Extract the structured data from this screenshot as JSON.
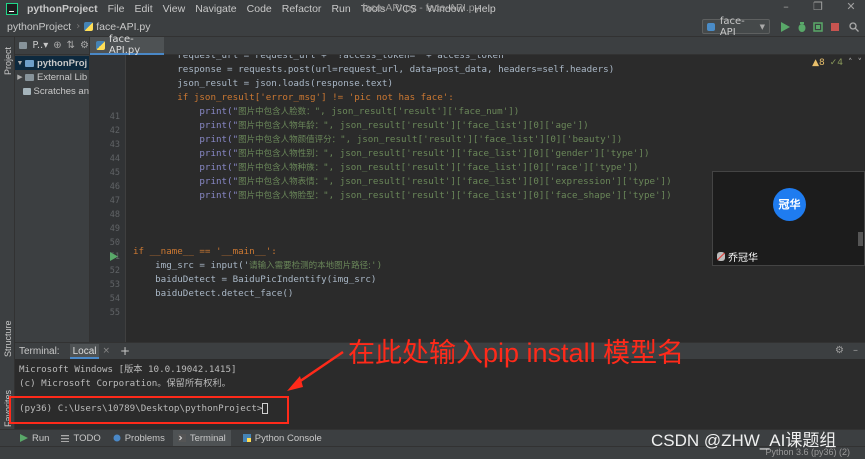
{
  "menubar": {
    "items": [
      "pythonProject",
      "File",
      "Edit",
      "View",
      "Navigate",
      "Code",
      "Refactor",
      "Run",
      "Tools",
      "VCS",
      "Window",
      "Help"
    ],
    "window_title": "face-API.py - face-API.py"
  },
  "navbar": {
    "breadcrumbs": [
      "pythonProject",
      "face-API.py"
    ],
    "run_config": "face-API"
  },
  "project_panel": {
    "title": "P..▾",
    "tree": [
      {
        "label": "pythonProj",
        "expanded": true
      },
      {
        "label": "External Lib",
        "expanded": false
      },
      {
        "label": "Scratches an",
        "expanded": false
      }
    ]
  },
  "left_stripe": {
    "top_label": "Project",
    "bottom_labels": [
      "Structure",
      "Favorites"
    ]
  },
  "editor": {
    "tab_label": "face-API.py",
    "inspections": {
      "warnings": "▲8",
      "weak": "✓4"
    },
    "line_numbers": [
      "",
      "",
      "",
      "",
      "41",
      "42",
      "43",
      "44",
      "45",
      "46",
      "47",
      "48",
      "49",
      "50",
      "51",
      "52",
      "53",
      "54",
      "55"
    ],
    "code": {
      "l0": "        request_url = request_url + \"?access_token=\" + access_token",
      "l1": "        response = requests.post(url=request_url, data=post_data, headers=self.headers)",
      "l2": "        json_result = json.loads(response.text)",
      "l3": "        if json_result['error_msg'] != 'pic not has face':",
      "l4_a": "            print(\"",
      "l4_cn": "图片中包含人脸数：",
      "l4_b": "\", json_result['result']['face_num'])",
      "l5_cn": "图片中包含人物年龄：",
      "l5_b": "\", json_result['result']['face_list'][0]['age'])",
      "l6_cn": "图片中包含人物颜值评分：",
      "l6_b": "\", json_result['result']['face_list'][0]['beauty'])",
      "l7_cn": "图片中包含人物性别：",
      "l7_b": "\", json_result['result']['face_list'][0]['gender']['type'])",
      "l8_cn": "图片中包含人物种族：",
      "l8_b": "\", json_result['result']['face_list'][0]['race']['type'])",
      "l9_cn": "图片中包含人物表情：",
      "l9_b": "\", json_result['result']['face_list'][0]['expression']['type'])",
      "l10_cn": "图片中包含人物脸型：",
      "l10_b": "\", json_result['result']['face_list'][0]['face_shape']['type'])",
      "l14": "if __name__ == '__main__':",
      "l15_a": "    img_src = input('",
      "l15_cn": "请输入需要检测的本地图片路径:",
      "l15_b": "')",
      "l16": "    baiduDetect = BaiduPicIndentify(img_src)",
      "l17": "    baiduDetect.detect_face()"
    }
  },
  "video_overlay": {
    "avatar_text": "冠华",
    "participant_name": "乔冠华"
  },
  "terminal": {
    "title": "Terminal:",
    "tab": "Local",
    "lines": [
      "Microsoft Windows [版本 10.0.19042.1415]",
      "(c) Microsoft Corporation。保留所有权利。",
      "",
      "(py36) C:\\Users\\10789\\Desktop\\pythonProject>"
    ]
  },
  "annotation": {
    "text": "在此处输入pip install 模型名",
    "color": "#ff2a1a"
  },
  "tool_tabs": [
    "Run",
    "TODO",
    "Problems",
    "Terminal",
    "Python Console"
  ],
  "status_bar": {
    "interpreter": "Python 3.6 (py36) (2)"
  },
  "watermark": "CSDN @ZHW_AI课题组",
  "colors": {
    "keyword": "#cc7832",
    "string": "#6a8759",
    "parameter": "#aa4926",
    "self": "#94558d",
    "accent": "#4a88c7"
  }
}
